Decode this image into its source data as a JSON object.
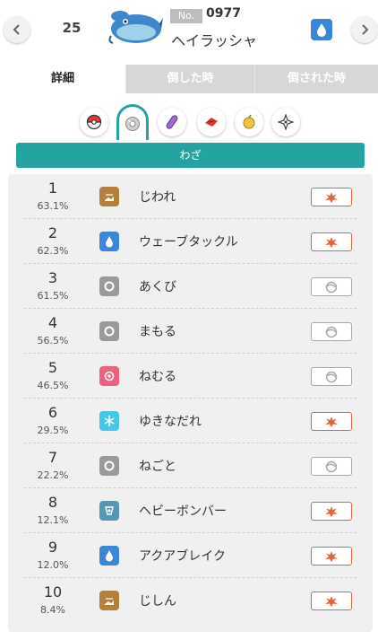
{
  "header": {
    "rank": "25",
    "dex_label": "No.",
    "dex_number": "0977",
    "pokemon_name": "ヘイラッシャ",
    "type_icon": "water-drop-icon",
    "type_color": "#3a86d9"
  },
  "tabs": [
    {
      "label": "詳細",
      "active": true
    },
    {
      "label": "倒した時",
      "active": false
    },
    {
      "label": "倒された時",
      "active": false
    }
  ],
  "categories": [
    {
      "icon": "pokeball-icon",
      "selected": false
    },
    {
      "icon": "move-disc-icon",
      "selected": true
    },
    {
      "icon": "held-item-icon",
      "selected": false
    },
    {
      "icon": "nature-icon",
      "selected": false
    },
    {
      "icon": "ability-icon",
      "selected": false
    },
    {
      "icon": "tera-type-icon",
      "selected": false
    }
  ],
  "section_title": "わざ",
  "moves": [
    {
      "rank": "1",
      "pct": "63.1%",
      "name": "じわれ",
      "type": "ground",
      "type_color": "#b1813c",
      "category": "physical"
    },
    {
      "rank": "2",
      "pct": "62.3%",
      "name": "ウェーブタックル",
      "type": "water",
      "type_color": "#3a86d9",
      "category": "physical"
    },
    {
      "rank": "3",
      "pct": "61.5%",
      "name": "あくび",
      "type": "normal",
      "type_color": "#9a9a9a",
      "category": "status"
    },
    {
      "rank": "4",
      "pct": "56.5%",
      "name": "まもる",
      "type": "normal",
      "type_color": "#9a9a9a",
      "category": "status"
    },
    {
      "rank": "5",
      "pct": "46.5%",
      "name": "ねむる",
      "type": "psychic",
      "type_color": "#ef5f7e",
      "category": "status"
    },
    {
      "rank": "6",
      "pct": "29.5%",
      "name": "ゆきなだれ",
      "type": "ice",
      "type_color": "#46c7e8",
      "category": "physical"
    },
    {
      "rank": "7",
      "pct": "22.2%",
      "name": "ねごと",
      "type": "normal",
      "type_color": "#9a9a9a",
      "category": "status"
    },
    {
      "rank": "8",
      "pct": "12.1%",
      "name": "ヘビーボンバー",
      "type": "steel",
      "type_color": "#5996b4",
      "category": "physical"
    },
    {
      "rank": "9",
      "pct": "12.0%",
      "name": "アクアブレイク",
      "type": "water",
      "type_color": "#3a86d9",
      "category": "physical"
    },
    {
      "rank": "10",
      "pct": "8.4%",
      "name": "じしん",
      "type": "ground",
      "type_color": "#b1813c",
      "category": "physical"
    }
  ],
  "colors": {
    "accent": "#24a3a0",
    "physical": "#e2663d",
    "status": "#a9a9a9"
  }
}
